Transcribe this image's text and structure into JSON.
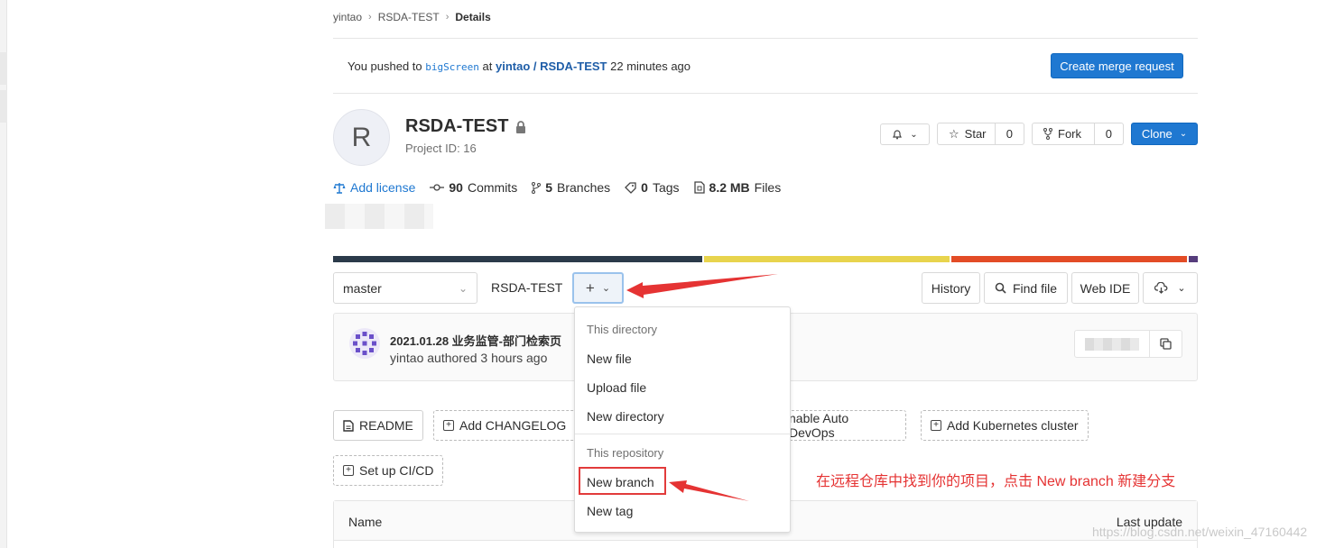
{
  "breadcrumb": {
    "items": [
      "yintao",
      "RSDA-TEST"
    ],
    "current": "Details"
  },
  "push_alert": {
    "prefix": "You pushed to",
    "branch": "bigScreen",
    "at": "at",
    "project": "yintao / RSDA-TEST",
    "time": "22 minutes ago",
    "button": "Create merge request"
  },
  "project": {
    "avatar_letter": "R",
    "name": "RSDA-TEST",
    "id_text": "Project ID: 16",
    "star_label": "Star",
    "star_count": "0",
    "fork_label": "Fork",
    "fork_count": "0",
    "clone_label": "Clone"
  },
  "stats": {
    "license": "Add license",
    "commits_num": "90",
    "commits_label": "Commits",
    "branches_num": "5",
    "branches_label": "Branches",
    "tags_num": "0",
    "tags_label": "Tags",
    "size_num": "8.2 MB",
    "size_label": "Files"
  },
  "language_bar": {
    "colors": [
      "#2b3a4a",
      "#e8d44d",
      "#e34c26",
      "#563d7c"
    ],
    "shares": [
      0.43,
      0.285,
      0.275,
      0.01
    ]
  },
  "toolbar": {
    "branch": "master",
    "path": "RSDA-TEST",
    "slash": "/",
    "plus": "+",
    "history": "History",
    "find_file": "Find file",
    "web_ide": "Web IDE"
  },
  "commit": {
    "title": "2021.01.28 业务监管-部门检索页",
    "author": "yintao",
    "meta": "authored 3 hours ago"
  },
  "buttons": {
    "readme": "README",
    "changelog": "Add CHANGELOG",
    "auto_devops": "nable Auto DevOps",
    "kubernetes": "Add Kubernetes cluster",
    "cicd": "Set up CI/CD"
  },
  "table": {
    "col_name": "Name",
    "col_update": "Last update"
  },
  "dropdown": {
    "header_dir": "This directory",
    "new_file": "New file",
    "upload_file": "Upload file",
    "new_directory": "New directory",
    "header_repo": "This repository",
    "new_branch": "New branch",
    "new_tag": "New tag"
  },
  "annotation": "在远程仓库中找到你的项目，点击 New branch 新建分支",
  "watermark": "https://blog.csdn.net/weixin_47160442",
  "colors": {
    "accent": "#1f78d1",
    "annotation": "#e53333"
  }
}
